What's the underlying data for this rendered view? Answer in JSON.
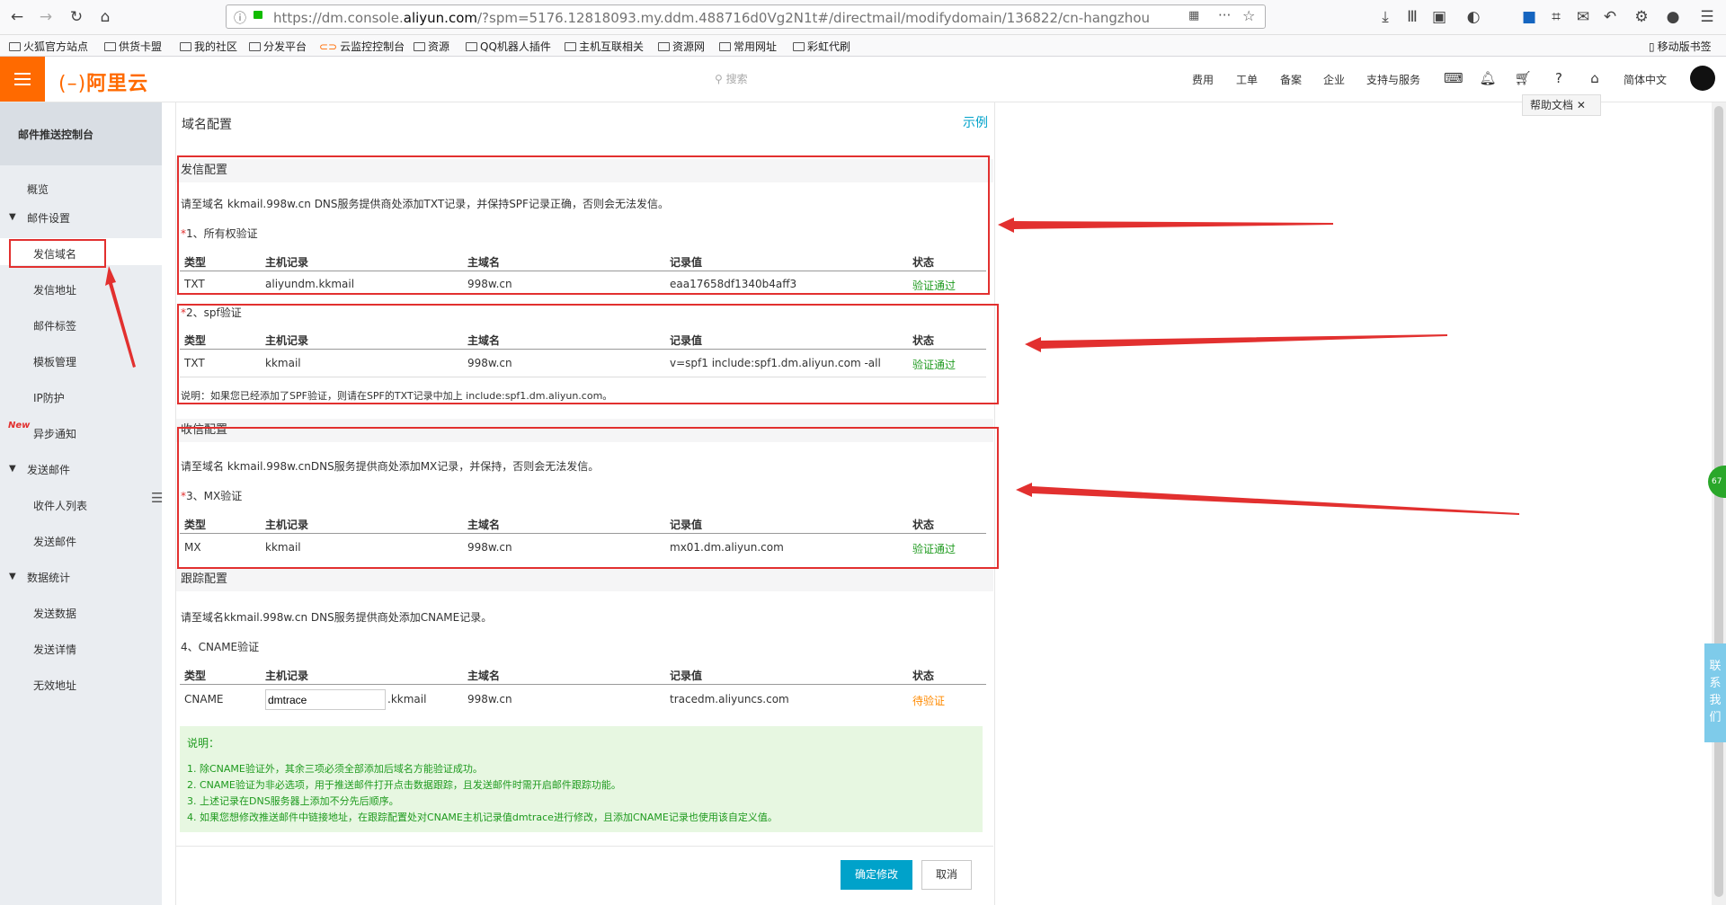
{
  "browser": {
    "url_prefix": "https://dm.console.",
    "url_domain": "aliyun.com",
    "url_rest": "/?spm=5176.12818093.my.ddm.488716d0Vg2N1t#/directmail/modifydomain/136822/cn-hangzhou",
    "bookmarks": [
      "火狐官方站点",
      "供货卡盟",
      "我的社区",
      "分发平台",
      "云监控控制台",
      "资源",
      "QQ机器人插件",
      "主机互联相关",
      "资源网",
      "常用网址",
      "彩虹代刷"
    ],
    "mobile_bookmarks": "移动版书签"
  },
  "topbar": {
    "logo": "阿里云",
    "search_placeholder": "搜索",
    "nav": [
      "费用",
      "工单",
      "备案",
      "企业",
      "支持与服务"
    ],
    "language": "简体中文",
    "help_tooltip": "帮助文档"
  },
  "sidebar": {
    "title": "邮件推送控制台",
    "overview": "概览",
    "groups": [
      {
        "label": "邮件设置",
        "items": [
          "发信域名",
          "发信地址",
          "邮件标签",
          "模板管理",
          "IP防护",
          "异步通知"
        ]
      },
      {
        "label": "发送邮件",
        "items": [
          "收件人列表",
          "发送邮件"
        ]
      },
      {
        "label": "数据统计",
        "items": [
          "发送数据",
          "发送详情",
          "无效地址"
        ]
      }
    ],
    "new_badge": "New"
  },
  "main": {
    "title": "域名配置",
    "example_link": "示例",
    "columns": [
      "类型",
      "主机记录",
      "主域名",
      "记录值",
      "状态"
    ],
    "send": {
      "heading": "发信配置",
      "desc": "请至域名 kkmail.998w.cn DNS服务提供商处添加TXT记录，并保持SPF记录正确，否则会无法发信。",
      "ownership_label": "1、所有权验证",
      "ownership_row": [
        "TXT",
        "aliyundm.kkmail",
        "998w.cn",
        "eaa17658df1340b4aff3",
        "验证通过"
      ],
      "spf_label": "2、spf验证",
      "spf_row": [
        "TXT",
        "kkmail",
        "998w.cn",
        "v=spf1 include:spf1.dm.aliyun.com -all",
        "验证通过"
      ],
      "spf_note": "说明：如果您已经添加了SPF验证，则请在SPF的TXT记录中加上 include:spf1.dm.aliyun.com。"
    },
    "receive": {
      "heading": "收信配置",
      "desc": "请至域名 kkmail.998w.cnDNS服务提供商处添加MX记录，并保持，否则会无法发信。",
      "mx_label": "3、MX验证",
      "mx_row": [
        "MX",
        "kkmail",
        "998w.cn",
        "mx01.dm.aliyun.com",
        "验证通过"
      ]
    },
    "track": {
      "heading": "跟踪配置",
      "desc": "请至域名kkmail.998w.cn DNS服务提供商处添加CNAME记录。",
      "cname_label": "4、CNAME验证",
      "cname_type": "CNAME",
      "cname_input": "dmtrace",
      "cname_suffix": ".kkmail",
      "cname_domain": "998w.cn",
      "cname_value": "tracedm.aliyuncs.com",
      "cname_status": "待验证"
    },
    "notes": {
      "title": "说明：",
      "lines": [
        "1. 除CNAME验证外，其余三项必须全部添加后域名方能验证成功。",
        "2. CNAME验证为非必选项，用于推送邮件打开点击数据跟踪，且发送邮件时需开启邮件跟踪功能。",
        "3. 上述记录在DNS服务器上添加不分先后顺序。",
        "4. 如果您想修改推送邮件中链接地址，在跟踪配置处对CNAME主机记录值dmtrace进行修改，且添加CNAME记录也使用该自定义值。"
      ]
    },
    "confirm_button": "确定修改",
    "cancel_button": "取消"
  },
  "float": {
    "contact": [
      "联",
      "系",
      "我",
      "们"
    ],
    "badge": "67"
  },
  "colors": {
    "brand": "#ff6a00",
    "ok": "#1e9a1e",
    "pending": "#ff8a00",
    "highlight": "#e2302f",
    "primary_button": "#00a2ca"
  }
}
